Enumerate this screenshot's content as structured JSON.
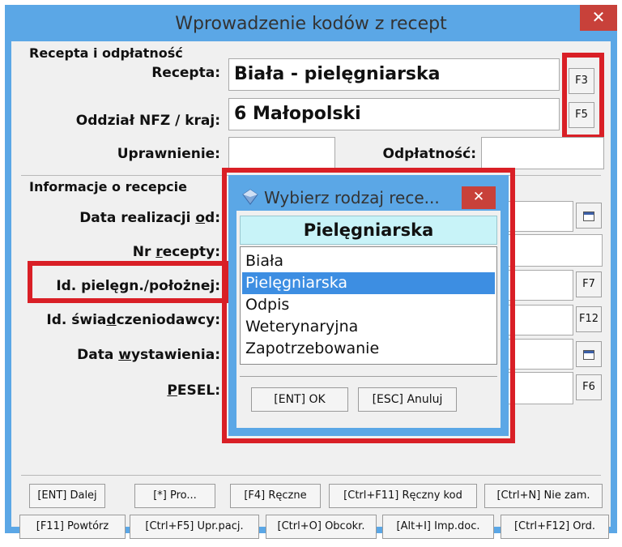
{
  "window": {
    "title": "Wprowadzenie kodów z recept",
    "close_symbol": "✕"
  },
  "recipe_section": {
    "heading": "Recepta i odpłatność",
    "recepta_label": "Recepta:",
    "recepta_value": "Biała - pielęgniarska",
    "recepta_btn": "F3",
    "oddzial_label": "Oddział NFZ / kraj:",
    "oddzial_value": "6 Małopolski",
    "oddzial_btn": "F5",
    "uprawnienie_label": "Uprawnienie:",
    "uprawnienie_value": "",
    "odplatnosc_label": "Odpłatność:",
    "odplatnosc_value": ""
  },
  "info_section": {
    "heading": "Informacje o recepcie",
    "data_realizacji": {
      "pre": "Data realizacji ",
      "u": "o",
      "post": "d:"
    },
    "nr_recepty": {
      "pre": "Nr ",
      "u": "r",
      "post": "ecepty:"
    },
    "id_pielegn_label": "Id. pielęgn./położnej:",
    "id_pielegn_btn": "F7",
    "id_swiad": {
      "pre": "Id. świa",
      "u": "d",
      "post": "czeniodawcy:"
    },
    "id_swiad_btn": "F12",
    "data_wyst": {
      "pre": "Data ",
      "u": "w",
      "post": "ystawienia:"
    },
    "pesel": {
      "pre": "",
      "u": "P",
      "post": "ESEL:"
    },
    "pesel_btn": "F6"
  },
  "popup": {
    "title": "Wybierz rodzaj rece...",
    "close_symbol": "✕",
    "header": "Pielęgniarska",
    "items": [
      "Biała",
      "Pielęgniarska",
      "Odpis",
      "Weterynaryjna",
      "Zapotrzebowanie"
    ],
    "selected_index": 1,
    "ok_label": "[ENT] OK",
    "cancel_label": "[ESC] Anuluj"
  },
  "bottom_buttons": {
    "row1": [
      "[ENT] Dalej",
      "[*] Pro...",
      "[F4] Ręczne",
      "[Ctrl+F11] Ręczny kod",
      "[Ctrl+N] Nie zam."
    ],
    "row2": [
      "[F11] Powtórz",
      "[Ctrl+F5] Upr.pacj.",
      "[Ctrl+O] Obcokr.",
      "[Alt+I] Imp.doc.",
      "[Ctrl+F12] Ord."
    ]
  },
  "colors": {
    "frame": "#5ba7e6",
    "highlight": "#d91f26",
    "selection": "#3d8ee2",
    "close": "#c8413a"
  }
}
